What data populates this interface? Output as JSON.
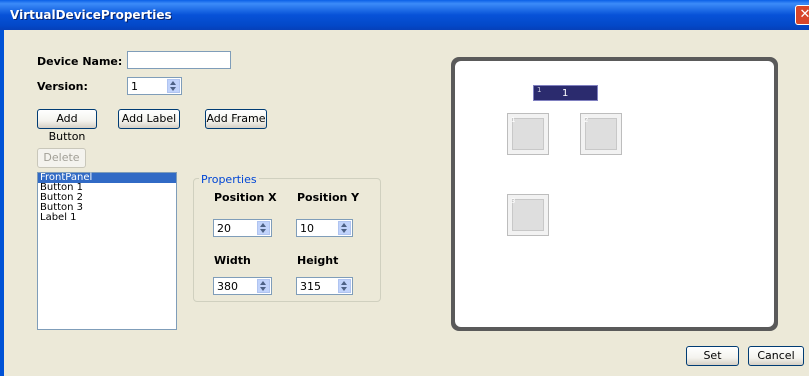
{
  "window": {
    "title": "VirtualDeviceProperties",
    "close_glyph": "✕"
  },
  "form": {
    "device_name_label": "Device Name:",
    "device_name_value": "",
    "version_label": "Version:",
    "version_value": "1"
  },
  "toolbar": {
    "add_button": "Add Button",
    "add_label": "Add Label",
    "add_frame": "Add Frame",
    "delete": "Delete"
  },
  "list": {
    "items": [
      {
        "label": "FrontPanel",
        "selected": true
      },
      {
        "label": "Button 1",
        "selected": false
      },
      {
        "label": "Button 2",
        "selected": false
      },
      {
        "label": "Button 3",
        "selected": false
      },
      {
        "label": "Label 1",
        "selected": false
      }
    ]
  },
  "properties": {
    "group_title": "Properties",
    "position_x_label": "Position  X",
    "position_y_label": "Position  Y",
    "width_label": "Width",
    "height_label": "Height",
    "position_x": "20",
    "position_y": "10",
    "width": "380",
    "height": "315"
  },
  "preview": {
    "label_index": "1",
    "label_text": "1",
    "button_indices": [
      "1",
      "2",
      "3"
    ]
  },
  "footer": {
    "set": "Set",
    "cancel": "Cancel"
  },
  "colors": {
    "titlebar": "#0752D8",
    "selection": "#316AC5",
    "label_bg": "#2B2B6E"
  }
}
